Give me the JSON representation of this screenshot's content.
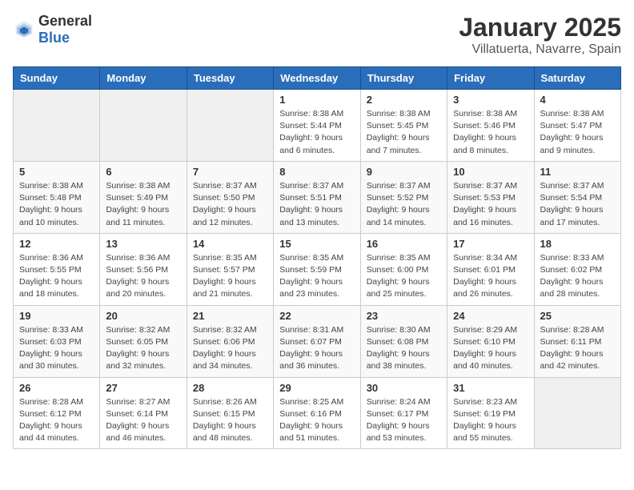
{
  "logo": {
    "general": "General",
    "blue": "Blue"
  },
  "header": {
    "month_year": "January 2025",
    "location": "Villatuerta, Navarre, Spain"
  },
  "weekdays": [
    "Sunday",
    "Monday",
    "Tuesday",
    "Wednesday",
    "Thursday",
    "Friday",
    "Saturday"
  ],
  "weeks": [
    [
      {
        "day": "",
        "info": ""
      },
      {
        "day": "",
        "info": ""
      },
      {
        "day": "",
        "info": ""
      },
      {
        "day": "1",
        "info": "Sunrise: 8:38 AM\nSunset: 5:44 PM\nDaylight: 9 hours and 6 minutes."
      },
      {
        "day": "2",
        "info": "Sunrise: 8:38 AM\nSunset: 5:45 PM\nDaylight: 9 hours and 7 minutes."
      },
      {
        "day": "3",
        "info": "Sunrise: 8:38 AM\nSunset: 5:46 PM\nDaylight: 9 hours and 8 minutes."
      },
      {
        "day": "4",
        "info": "Sunrise: 8:38 AM\nSunset: 5:47 PM\nDaylight: 9 hours and 9 minutes."
      }
    ],
    [
      {
        "day": "5",
        "info": "Sunrise: 8:38 AM\nSunset: 5:48 PM\nDaylight: 9 hours and 10 minutes."
      },
      {
        "day": "6",
        "info": "Sunrise: 8:38 AM\nSunset: 5:49 PM\nDaylight: 9 hours and 11 minutes."
      },
      {
        "day": "7",
        "info": "Sunrise: 8:37 AM\nSunset: 5:50 PM\nDaylight: 9 hours and 12 minutes."
      },
      {
        "day": "8",
        "info": "Sunrise: 8:37 AM\nSunset: 5:51 PM\nDaylight: 9 hours and 13 minutes."
      },
      {
        "day": "9",
        "info": "Sunrise: 8:37 AM\nSunset: 5:52 PM\nDaylight: 9 hours and 14 minutes."
      },
      {
        "day": "10",
        "info": "Sunrise: 8:37 AM\nSunset: 5:53 PM\nDaylight: 9 hours and 16 minutes."
      },
      {
        "day": "11",
        "info": "Sunrise: 8:37 AM\nSunset: 5:54 PM\nDaylight: 9 hours and 17 minutes."
      }
    ],
    [
      {
        "day": "12",
        "info": "Sunrise: 8:36 AM\nSunset: 5:55 PM\nDaylight: 9 hours and 18 minutes."
      },
      {
        "day": "13",
        "info": "Sunrise: 8:36 AM\nSunset: 5:56 PM\nDaylight: 9 hours and 20 minutes."
      },
      {
        "day": "14",
        "info": "Sunrise: 8:35 AM\nSunset: 5:57 PM\nDaylight: 9 hours and 21 minutes."
      },
      {
        "day": "15",
        "info": "Sunrise: 8:35 AM\nSunset: 5:59 PM\nDaylight: 9 hours and 23 minutes."
      },
      {
        "day": "16",
        "info": "Sunrise: 8:35 AM\nSunset: 6:00 PM\nDaylight: 9 hours and 25 minutes."
      },
      {
        "day": "17",
        "info": "Sunrise: 8:34 AM\nSunset: 6:01 PM\nDaylight: 9 hours and 26 minutes."
      },
      {
        "day": "18",
        "info": "Sunrise: 8:33 AM\nSunset: 6:02 PM\nDaylight: 9 hours and 28 minutes."
      }
    ],
    [
      {
        "day": "19",
        "info": "Sunrise: 8:33 AM\nSunset: 6:03 PM\nDaylight: 9 hours and 30 minutes."
      },
      {
        "day": "20",
        "info": "Sunrise: 8:32 AM\nSunset: 6:05 PM\nDaylight: 9 hours and 32 minutes."
      },
      {
        "day": "21",
        "info": "Sunrise: 8:32 AM\nSunset: 6:06 PM\nDaylight: 9 hours and 34 minutes."
      },
      {
        "day": "22",
        "info": "Sunrise: 8:31 AM\nSunset: 6:07 PM\nDaylight: 9 hours and 36 minutes."
      },
      {
        "day": "23",
        "info": "Sunrise: 8:30 AM\nSunset: 6:08 PM\nDaylight: 9 hours and 38 minutes."
      },
      {
        "day": "24",
        "info": "Sunrise: 8:29 AM\nSunset: 6:10 PM\nDaylight: 9 hours and 40 minutes."
      },
      {
        "day": "25",
        "info": "Sunrise: 8:28 AM\nSunset: 6:11 PM\nDaylight: 9 hours and 42 minutes."
      }
    ],
    [
      {
        "day": "26",
        "info": "Sunrise: 8:28 AM\nSunset: 6:12 PM\nDaylight: 9 hours and 44 minutes."
      },
      {
        "day": "27",
        "info": "Sunrise: 8:27 AM\nSunset: 6:14 PM\nDaylight: 9 hours and 46 minutes."
      },
      {
        "day": "28",
        "info": "Sunrise: 8:26 AM\nSunset: 6:15 PM\nDaylight: 9 hours and 48 minutes."
      },
      {
        "day": "29",
        "info": "Sunrise: 8:25 AM\nSunset: 6:16 PM\nDaylight: 9 hours and 51 minutes."
      },
      {
        "day": "30",
        "info": "Sunrise: 8:24 AM\nSunset: 6:17 PM\nDaylight: 9 hours and 53 minutes."
      },
      {
        "day": "31",
        "info": "Sunrise: 8:23 AM\nSunset: 6:19 PM\nDaylight: 9 hours and 55 minutes."
      },
      {
        "day": "",
        "info": ""
      }
    ]
  ]
}
